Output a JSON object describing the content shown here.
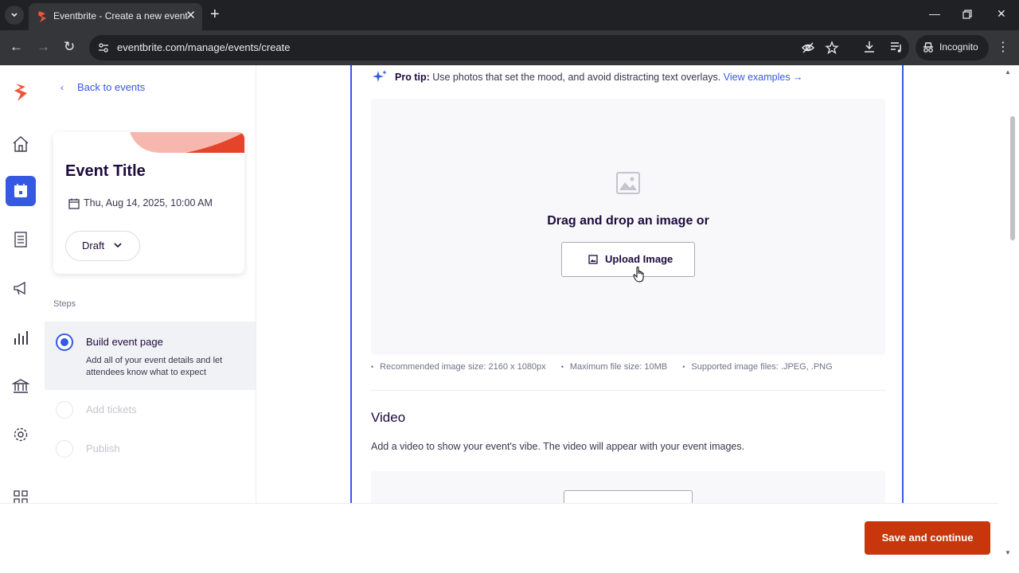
{
  "browser": {
    "tab_title": "Eventbrite - Create a new event",
    "url": "eventbrite.com/manage/events/create",
    "incognito_label": "Incognito"
  },
  "rail": {
    "items": [
      "home-icon",
      "calendar-icon",
      "orders-icon",
      "megaphone-icon",
      "reports-icon",
      "finance-icon",
      "settings-icon",
      "apps-icon"
    ],
    "active": "calendar-icon"
  },
  "side": {
    "back_label": "Back to events",
    "event_title": "Event Title",
    "event_date": "Thu, Aug 14, 2025, 10:00 AM",
    "status": "Draft",
    "steps_label": "Steps",
    "steps": [
      {
        "title": "Build event page",
        "desc": "Add all of your event details and let attendees know what to expect"
      },
      {
        "title": "Add tickets"
      },
      {
        "title": "Publish"
      }
    ]
  },
  "main": {
    "pro_tip_label": "Pro tip:",
    "pro_tip_text": "Use photos that set the mood, and avoid distracting text overlays.",
    "view_examples": "View examples →",
    "drop_text": "Drag and drop an image or",
    "upload_label": "Upload Image",
    "hints": [
      "Recommended image size: 2160 x 1080px",
      "Maximum file size: 10MB",
      "Supported image files: .JPEG, .PNG"
    ],
    "video_title": "Video",
    "video_desc": "Add a video to show your event's vibe. The video will appear with your event images."
  },
  "footer": {
    "save_label": "Save and continue"
  },
  "colors": {
    "brand": "#d1410c",
    "accent": "#3659e3",
    "save_button": "#c8360c"
  }
}
